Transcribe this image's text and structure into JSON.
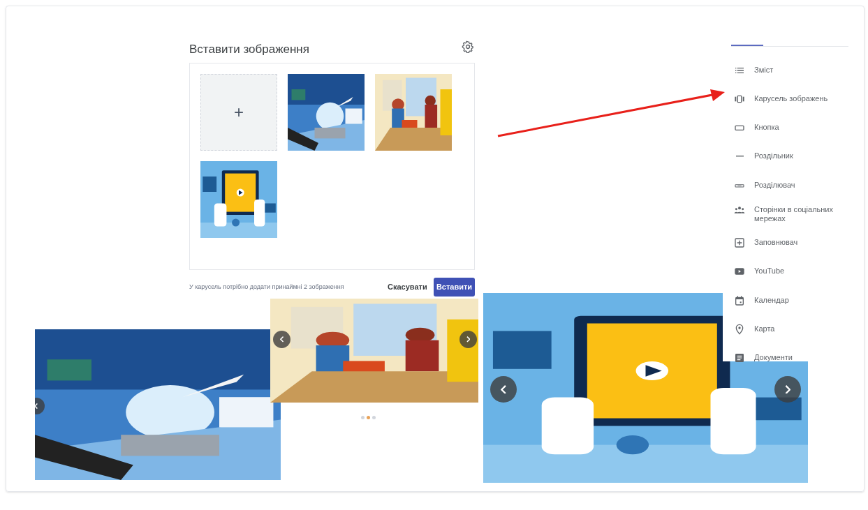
{
  "dialog": {
    "title": "Вставити зображення",
    "add_tile": "+",
    "images": [
      {
        "kind": "picture"
      },
      {
        "kind": "picture"
      },
      {
        "kind": "picture"
      }
    ],
    "hint": "У карусель потрібно додати принаймні 2 зображення",
    "buttons": [
      {
        "label": "Скасувати",
        "kind": "text"
      },
      {
        "label": "Вставити",
        "kind": "primary"
      }
    ]
  },
  "sidebar": {
    "tabs": [
      {
        "selected": true
      }
    ],
    "items": [
      {
        "kind": "list",
        "label": "Зміст"
      },
      {
        "kind": "carousel",
        "label": "Карусель зображень"
      },
      {
        "kind": "button",
        "label": "Кнопка"
      },
      {
        "kind": "divider",
        "label": "Роздільник"
      },
      {
        "kind": "spacer",
        "label": "Розділювач"
      },
      {
        "kind": "people",
        "label": "Сторінки в соціальних мережах"
      },
      {
        "kind": "placeholder",
        "label": "Заповнювач"
      },
      {
        "kind": "youtube",
        "label": "YouTube"
      },
      {
        "kind": "calendar",
        "label": "Календар"
      },
      {
        "kind": "map",
        "label": "Карта"
      },
      {
        "kind": "docs",
        "label": "Документи"
      }
    ]
  },
  "carousels": [
    {
      "picture": {
        "kind": "picture"
      },
      "arrows": [
        {
          "kind": "prev"
        }
      ]
    },
    {
      "picture": {
        "kind": "picture"
      },
      "arrows": [
        {
          "kind": "prev"
        },
        {
          "kind": "next"
        }
      ],
      "dots": [
        {
          "selected": false
        },
        {
          "selected": true
        },
        {
          "selected": false
        }
      ]
    },
    {
      "picture": {
        "kind": "picture"
      },
      "arrows": [
        {
          "kind": "prev"
        },
        {
          "kind": "next"
        }
      ]
    }
  ],
  "annotation": {
    "kind": "arrow"
  }
}
